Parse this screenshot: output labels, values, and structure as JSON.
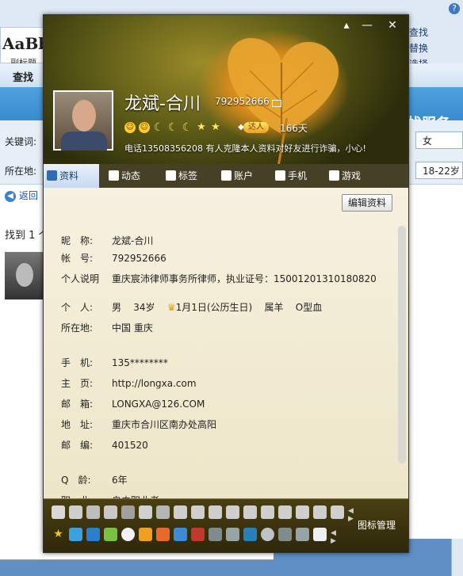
{
  "background": {
    "word_style_sample": "AaBb(",
    "word_style_name": "副标题",
    "word_find": "查找",
    "word_replace": "替换",
    "word_select": "选择",
    "find_window_title": "查找",
    "service_text": "找服务",
    "keyword_label": "关键词:",
    "location_label": "所在地:",
    "gender_value": "女",
    "age_value": "18-22岁",
    "back_label": "返回",
    "found_text": "找到 1 个"
  },
  "card": {
    "nickname": "龙斌-合川",
    "qq_number": "792952666",
    "vip_label": "达人",
    "vip_days": "166天",
    "signature": "电话13508356208 有人克隆本人资料对好友进行诈骗，小心!",
    "tabs": [
      {
        "label": "资料",
        "icon": "profile-card-icon"
      },
      {
        "label": "动态",
        "icon": "list-icon"
      },
      {
        "label": "标签",
        "icon": "bookmark-icon"
      },
      {
        "label": "账户",
        "icon": "briefcase-icon"
      },
      {
        "label": "手机",
        "icon": "phone-icon"
      },
      {
        "label": "游戏",
        "icon": "gamepad-icon"
      }
    ],
    "edit_button": "编辑资料",
    "fields": {
      "nick_key": "昵　称:",
      "nick_val": "龙斌-合川",
      "acct_key": "帐　号:",
      "acct_val": "792952666",
      "desc_key": "个人说明",
      "desc_val": "重庆宸沛律师事务所律师，执业证号：15001201310180820",
      "person_key": "个　人:",
      "gender": "男",
      "age": "34岁",
      "birthday": "1月1日(公历生日)",
      "zodiac": "属羊",
      "blood": "O型血",
      "loc_key": "所在地:",
      "loc_val": "中国 重庆",
      "mobile_key": "手　机:",
      "mobile_val": "135********",
      "home_key": "主　页:",
      "home_val": "http://longxa.com",
      "email_key": "邮　箱:",
      "email_val": "LONGXA@126.COM",
      "addr_key": "地　址:",
      "addr_val": "重庆市合川区南办处高阳",
      "zip_key": "邮　编:",
      "zip_val": "401520",
      "qage_key": "Q　龄:",
      "qage_val": "6年",
      "job_key": "职　业:",
      "job_val": "自由职业者"
    },
    "icon_manage": "图标管理"
  },
  "colors": {
    "header_gold": "#d88a1b",
    "tab_active": "#c7daf0",
    "content_bg": "#f3edd7",
    "iconbar_bg": "#3a320c"
  }
}
